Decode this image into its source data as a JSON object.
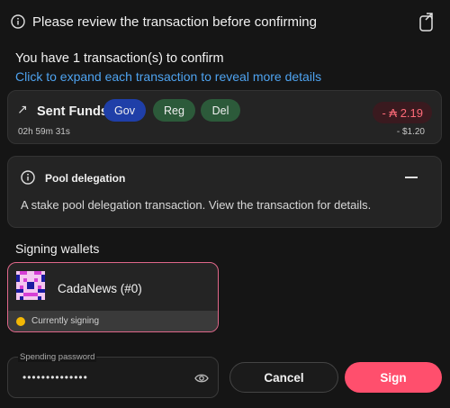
{
  "header": {
    "title": "Please review the transaction before confirming",
    "info_icon": "info-circle-icon",
    "popout_icon": "popout-icon"
  },
  "summary": {
    "count_text": "You have 1 transaction(s) to confirm",
    "expand_hint": "Click to expand each transaction to reveal more details"
  },
  "transaction": {
    "direction_icon": "arrow-up-right-icon",
    "title": "Sent Funds",
    "time": "02h 59m 31s",
    "badges": [
      "Gov",
      "Reg",
      "Del"
    ],
    "amount": "- ₳ 2.19",
    "fiat": "- $1.20",
    "colors": {
      "gov": "#1f3fa8",
      "reg_del": "#2c5a3a",
      "amount": "#ff6b78"
    }
  },
  "delegation": {
    "title": "Pool delegation",
    "description": "A stake pool delegation transaction. View the transaction for details.",
    "collapse_icon": "minus-icon"
  },
  "signing": {
    "label": "Signing wallets",
    "wallet_name": "CadaNews (#0)",
    "status": "Currently signing",
    "status_color": "#f2b705",
    "accent": "#e0678a"
  },
  "password": {
    "label": "Spending password",
    "value": "••••••••••••••",
    "eye_icon": "eye-icon"
  },
  "actions": {
    "cancel_label": "Cancel",
    "sign_label": "Sign",
    "sign_color": "#ff4f6d"
  }
}
